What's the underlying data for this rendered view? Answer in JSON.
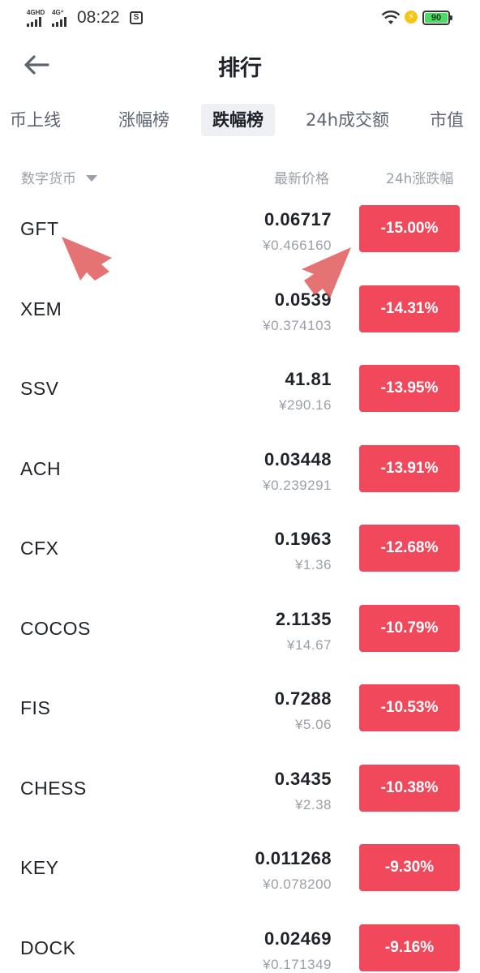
{
  "status_bar": {
    "net1": "4GHD",
    "net2": "4G⁺",
    "time": "08:22",
    "sim_icon": "sim-card-icon",
    "battery": "90",
    "wifi_icon": "wifi-icon",
    "charging_icon": "lightning-icon"
  },
  "header": {
    "back_icon": "arrow-left-icon",
    "title": "排行"
  },
  "tabs": [
    {
      "label": "币上线"
    },
    {
      "label": "涨幅榜"
    },
    {
      "label": "跌幅榜"
    },
    {
      "label": "24h成交额"
    },
    {
      "label": "市值"
    }
  ],
  "active_tab": "跌幅榜",
  "columns": {
    "coin": "数字货币",
    "price": "最新价格",
    "change": "24h涨跌幅"
  },
  "rows": [
    {
      "symbol": "GFT",
      "price": "0.06717",
      "cny": "¥0.466160",
      "change": "-15.00%"
    },
    {
      "symbol": "XEM",
      "price": "0.0539",
      "cny": "¥0.374103",
      "change": "-14.31%"
    },
    {
      "symbol": "SSV",
      "price": "41.81",
      "cny": "¥290.16",
      "change": "-13.95%"
    },
    {
      "symbol": "ACH",
      "price": "0.03448",
      "cny": "¥0.239291",
      "change": "-13.91%"
    },
    {
      "symbol": "CFX",
      "price": "0.1963",
      "cny": "¥1.36",
      "change": "-12.68%"
    },
    {
      "symbol": "COCOS",
      "price": "2.1135",
      "cny": "¥14.67",
      "change": "-10.79%"
    },
    {
      "symbol": "FIS",
      "price": "0.7288",
      "cny": "¥5.06",
      "change": "-10.53%"
    },
    {
      "symbol": "CHESS",
      "price": "0.3435",
      "cny": "¥2.38",
      "change": "-10.38%"
    },
    {
      "symbol": "KEY",
      "price": "0.011268",
      "cny": "¥0.078200",
      "change": "-9.30%"
    },
    {
      "symbol": "DOCK",
      "price": "0.02469",
      "cny": "¥0.171349",
      "change": "-9.16%"
    }
  ],
  "colors": {
    "down": "#f1495b",
    "text": "#1f2329",
    "muted": "#9aa0a8",
    "annotation": "#e05a5a"
  }
}
